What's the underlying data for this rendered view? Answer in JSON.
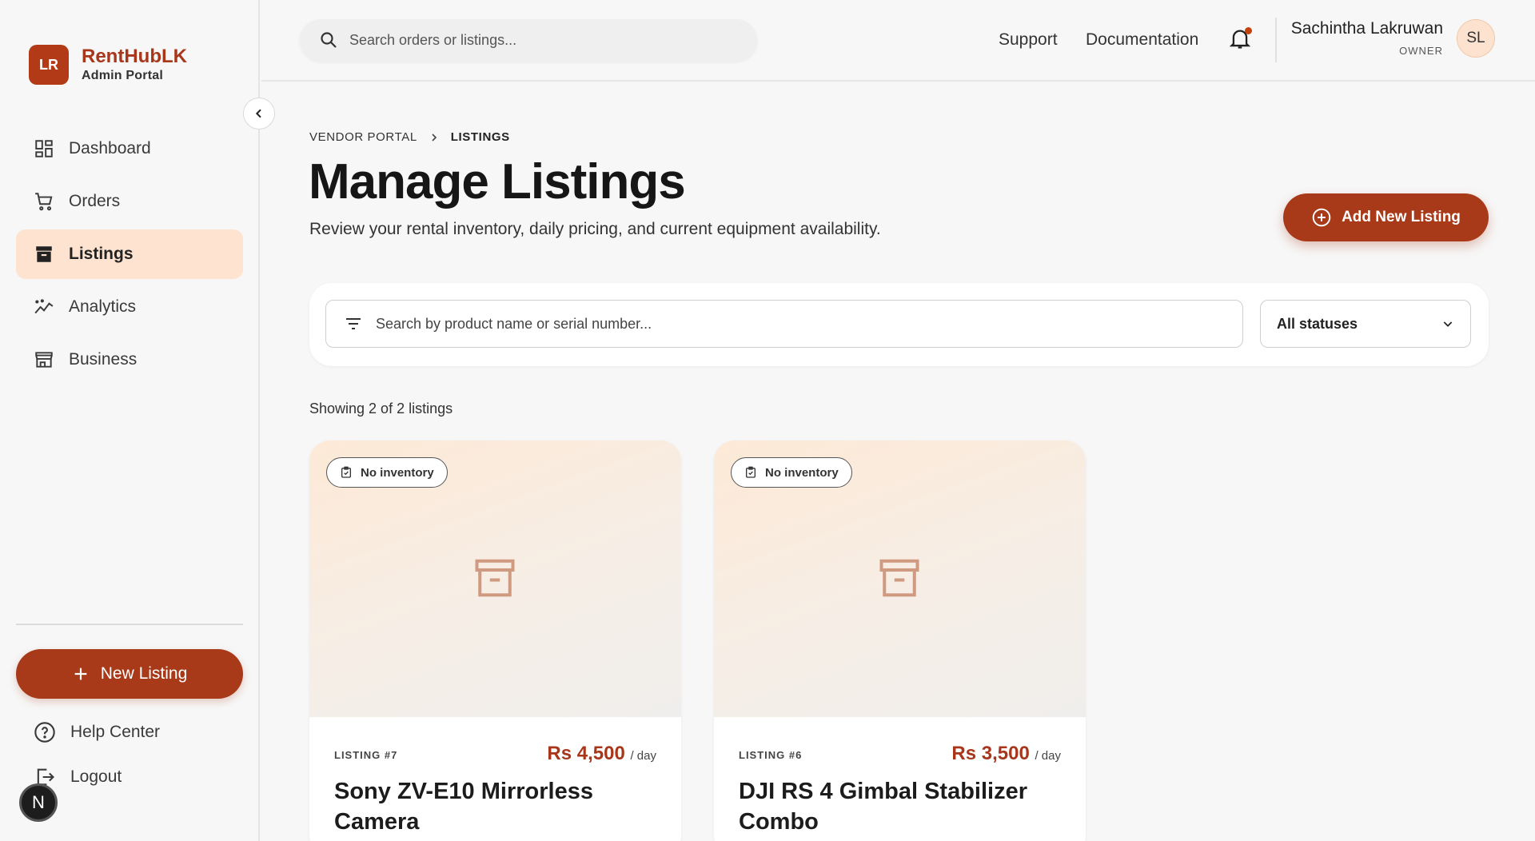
{
  "brand": {
    "logo": "LR",
    "name": "RentHubLK",
    "subtitle": "Admin Portal"
  },
  "sidebar": {
    "items": [
      {
        "label": "Dashboard",
        "icon": "dashboard-icon",
        "active": false
      },
      {
        "label": "Orders",
        "icon": "cart-icon",
        "active": false
      },
      {
        "label": "Listings",
        "icon": "archive-icon",
        "active": true
      },
      {
        "label": "Analytics",
        "icon": "analytics-icon",
        "active": false
      },
      {
        "label": "Business",
        "icon": "store-icon",
        "active": false
      }
    ],
    "new_listing_label": "New Listing",
    "help_label": "Help Center",
    "logout_label": "Logout",
    "n_badge": "N"
  },
  "header": {
    "search_placeholder": "Search orders or listings...",
    "support": "Support",
    "documentation": "Documentation",
    "user_name": "Sachintha Lakruwan",
    "user_role": "OWNER",
    "avatar": "SL"
  },
  "main": {
    "breadcrumb": [
      "VENDOR PORTAL",
      "LISTINGS"
    ],
    "title": "Manage Listings",
    "subtitle": "Review your rental inventory, daily pricing, and current equipment availability.",
    "add_button": "Add New Listing",
    "filter_placeholder": "Search by product name or serial number...",
    "status_select": "All statuses",
    "showing": "Showing 2 of 2 listings"
  },
  "listings": [
    {
      "badge": "No inventory",
      "number": "LISTING #7",
      "price": "Rs 4,500",
      "per": "/ day",
      "title": "Sony ZV-E10 Mirrorless Camera"
    },
    {
      "badge": "No inventory",
      "number": "LISTING #6",
      "price": "Rs 3,500",
      "per": "/ day",
      "title": "DJI RS 4 Gimbal Stabilizer Combo"
    }
  ],
  "colors": {
    "accent": "#a83a19",
    "active_bg": "#fde3d0"
  }
}
